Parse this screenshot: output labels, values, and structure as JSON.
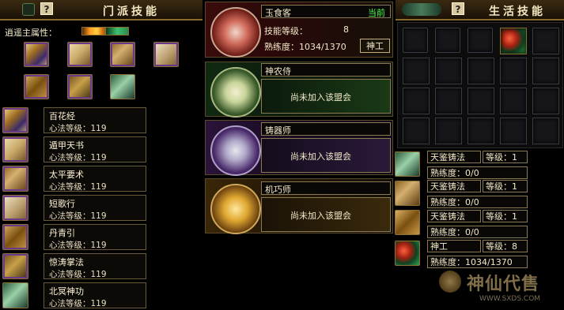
{
  "sect_panel": {
    "title": "门派技能",
    "help": "?",
    "main_attr_label": "逍遥主属性：",
    "skills": [
      {
        "name": "百花经",
        "level": "心法等级：119"
      },
      {
        "name": "遁甲天书",
        "level": "心法等级：119"
      },
      {
        "name": "太平要术",
        "level": "心法等级：119"
      },
      {
        "name": "短歌行",
        "level": "心法等级：119"
      },
      {
        "name": "丹青引",
        "level": "心法等级：119"
      },
      {
        "name": "惊涛掌法",
        "level": "心法等级：119"
      },
      {
        "name": "北冥神功",
        "level": "心法等级：119"
      }
    ]
  },
  "professions": [
    {
      "name": "玉食客",
      "current": "当前",
      "level_label": "技能等级：",
      "level": "8",
      "proficiency": "熟练度：1034/1370",
      "button": "神工"
    },
    {
      "name": "神农侍",
      "status": "尚未加入该盟会"
    },
    {
      "name": "铸器师",
      "status": "尚未加入该盟会"
    },
    {
      "name": "机巧师",
      "status": "尚未加入该盟会"
    }
  ],
  "life_panel": {
    "title": "生活技能",
    "help": "?",
    "skills": [
      {
        "name": "天鉴铸法",
        "level": "等级：1",
        "proficiency": "熟练度：0/0"
      },
      {
        "name": "天鉴铸法",
        "level": "等级：1",
        "proficiency": "熟练度：0/0"
      },
      {
        "name": "天鉴铸法",
        "level": "等级：1",
        "proficiency": "熟练度：0/0"
      },
      {
        "name": "神工",
        "level": "等级：8",
        "proficiency": "熟练度：1034/1370"
      }
    ]
  },
  "watermark": {
    "brand": "神仙代售",
    "url": "WWW.SXDS.COM"
  }
}
